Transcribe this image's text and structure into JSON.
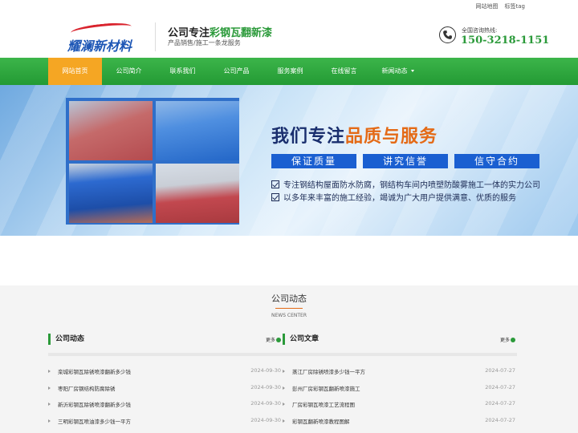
{
  "topbar": {
    "sitemap": "网站地图",
    "tags": "标签tag"
  },
  "header": {
    "logo_text": "耀澜新材料",
    "slogan_prefix": "公司专注",
    "slogan_highlight": "彩钢瓦翻新漆",
    "subslogan": "产品销售/施工一条龙服务",
    "hotline_label": "全国咨询热线:",
    "hotline_number": "150-3218-1151"
  },
  "nav": {
    "items": [
      {
        "label": "网站首页"
      },
      {
        "label": "公司简介"
      },
      {
        "label": "联系我们"
      },
      {
        "label": "公司产品"
      },
      {
        "label": "服务案例"
      },
      {
        "label": "在线留言"
      },
      {
        "label": "新闻动态"
      }
    ]
  },
  "banner": {
    "title_prefix": "我们专注",
    "title_highlight": "品质与服务",
    "tags": [
      "保证质量",
      "讲究信誉",
      "信守合约"
    ],
    "line1": "专注钢结构屋面防水防腐，钢结构车间内喷塑防酸雾施工一体的实力公司",
    "line2": "以多年来丰富的施工经验，竭诚为广大用户提供满意、优质的服务"
  },
  "news_section": {
    "title": "公司动态",
    "subtitle": "NEWS CENTER"
  },
  "company_news": {
    "title": "公司动态",
    "more": "更多",
    "items": [
      {
        "title": "栾城彩钢瓦除锈喷漆翻新多少钱",
        "date": "2024-09-30"
      },
      {
        "title": "枣阳厂房钢结构防腐除锈",
        "date": "2024-09-30"
      },
      {
        "title": "新沂彩钢瓦除锈喷漆翻新多少钱",
        "date": "2024-09-30"
      },
      {
        "title": "三明彩钢瓦喷油漆多少钱一平方",
        "date": "2024-09-30"
      }
    ]
  },
  "company_articles": {
    "title": "公司文章",
    "more": "更多",
    "items": [
      {
        "title": "蒸江厂房除锈喷漆多少钱一平方",
        "date": "2024-07-27"
      },
      {
        "title": "彭州厂房彩钢瓦翻新喷漆施工",
        "date": "2024-07-27"
      },
      {
        "title": "厂房彩钢瓦喷漆工艺流程图",
        "date": "2024-07-27"
      },
      {
        "title": "彩钢瓦翻新喷漆教程图解",
        "date": "2024-07-27"
      }
    ]
  }
}
